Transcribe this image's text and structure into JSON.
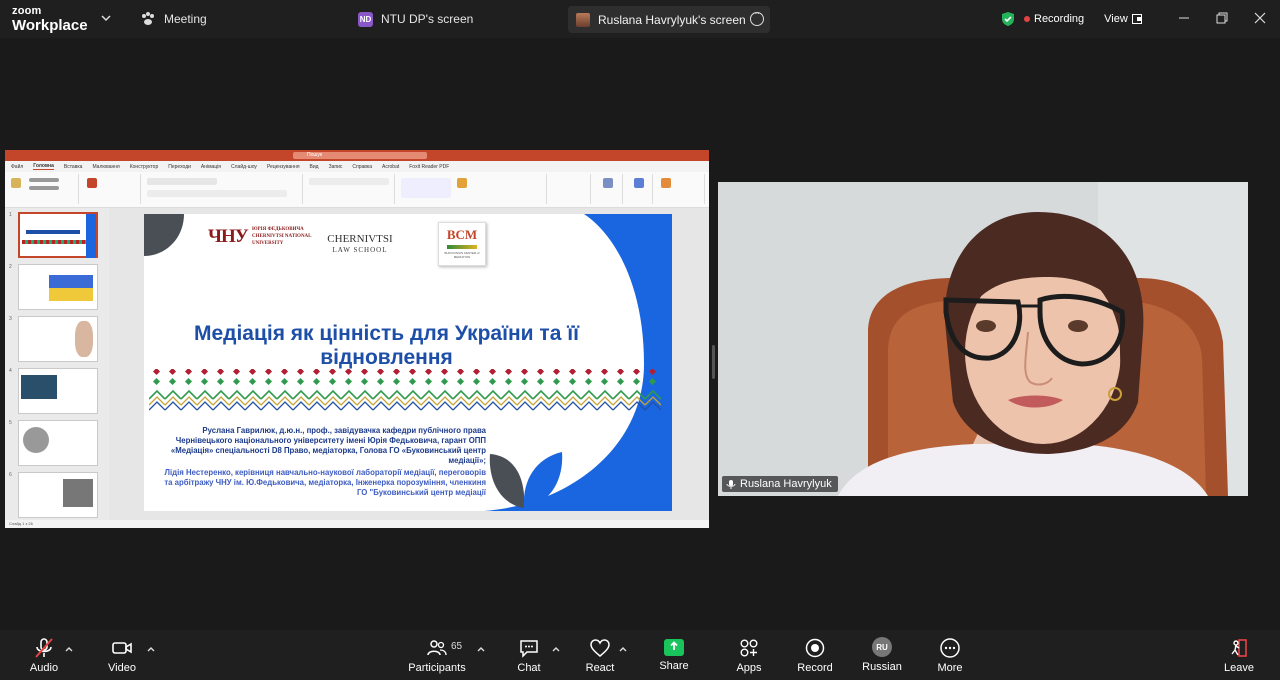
{
  "topbar": {
    "logo_line1": "zoom",
    "logo_line2": "Workplace",
    "meeting_tab": "Meeting",
    "share_tab1_badge": "ND",
    "share_tab1": "NTU DP's screen",
    "share_tab2": "Ruslana Havrylyuk's screen",
    "recording": "Recording",
    "view": "View"
  },
  "slide": {
    "chnu_text": "ЮРІЯ ФЕДЬКОВИЧА CHERNIVTSI NATIONAL UNIVERSITY",
    "chnu_mark": "ЧНУ",
    "law_line1": "CHERNIVTSI",
    "law_line2": "LAW SCHOOL",
    "bcm_mark": "BCM",
    "bcm_sub": "BUKOVINIAN CENTER of MEDIATION",
    "title": "Медіація як цінність для України та її відновлення",
    "author1": "Руслана Гаврилюк, д.ю.н., проф., завідувачка кафедри публічного права Чернівецького національного університету імені Юрія Федьковича, гарант ОПП «Медіація» спеціальності D8 Право, медіаторка, Голова ГО «Буковинський центр медіації»;",
    "author2": "Лідія Нестеренко, керівниця навчально-наукової лабораторії медіації, переговорів та арбітражу ЧНУ ім. Ю.Федьковича, медіаторка, Інженерка порозуміння, членкиня ГО \"Буковинський центр медіації"
  },
  "ppt": {
    "search": "Пошук",
    "menu": [
      "Файл",
      "Головна",
      "Вставка",
      "Малювання",
      "Конструктор",
      "Переходи",
      "Анімація",
      "Слайд-шоу",
      "Рецензування",
      "Вид",
      "Запис",
      "Справка",
      "Acrobat",
      "Foxit Reader PDF"
    ],
    "status": "Слайд 1 з 26"
  },
  "video": {
    "name": "Ruslana Havrylyuk"
  },
  "toolbar": {
    "audio": "Audio",
    "video": "Video",
    "participants": "Participants",
    "participants_count": "65",
    "chat": "Chat",
    "react": "React",
    "share": "Share",
    "apps": "Apps",
    "record": "Record",
    "language": "Russian",
    "language_badge": "RU",
    "more": "More",
    "leave": "Leave"
  }
}
